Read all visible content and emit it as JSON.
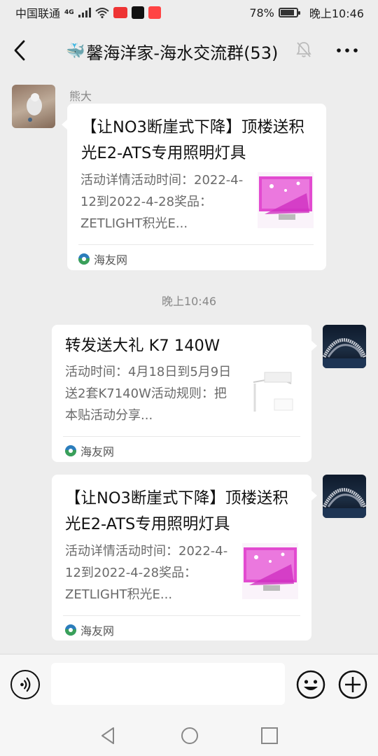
{
  "status_bar": {
    "carrier": "中国联通",
    "network_badge": "4G",
    "battery_percent": "78%",
    "battery_level": 0.78,
    "time": "晚上10:46",
    "icons": [
      "signal-icon",
      "wifi-icon",
      "app-news-icon",
      "tiktok-icon",
      "app-red-icon",
      "battery-icon"
    ]
  },
  "header": {
    "title": "馨海洋家-海水交流群(53)",
    "emoji": "🐳",
    "back_icon": "back-arrow-icon",
    "mute_icon": "bell-muted-icon",
    "more_icon": "more-dots-icon"
  },
  "messages": [
    {
      "sender": "熊大",
      "side": "left",
      "card": {
        "title": "【让NO3断崖式下降】顶楼送积光E2-ATS专用照明灯具",
        "desc": "活动详情活动时间：2022-4-12到2022-4-28奖品：ZETLIGHT积光E...",
        "source": "海友网"
      }
    },
    {
      "timestamp": "晚上10:46"
    },
    {
      "side": "right",
      "card": {
        "title": "转发送大礼 K7 140W",
        "desc": "活动时间：4月18日到5月9日送2套K7140W活动规则：把本贴活动分享...",
        "source": "海友网"
      }
    },
    {
      "side": "right",
      "card": {
        "title": "【让NO3断崖式下降】顶楼送积光E2-ATS专用照明灯具",
        "desc": "活动详情活动时间：2022-4-12到2022-4-28奖品：ZETLIGHT积光E...",
        "source": "海友网"
      }
    }
  ],
  "input_bar": {
    "voice_icon": "voice-icon",
    "input_value": "",
    "emoji_icon": "emoji-icon",
    "plus_icon": "plus-icon"
  },
  "nav_bar": {
    "icons": [
      "nav-back-icon",
      "nav-home-icon",
      "nav-recent-icon"
    ]
  },
  "colors": {
    "background": "#ededed",
    "card": "#ffffff",
    "text_primary": "#111111",
    "text_secondary": "#888888",
    "thumb_magenta": "#e020c8"
  }
}
